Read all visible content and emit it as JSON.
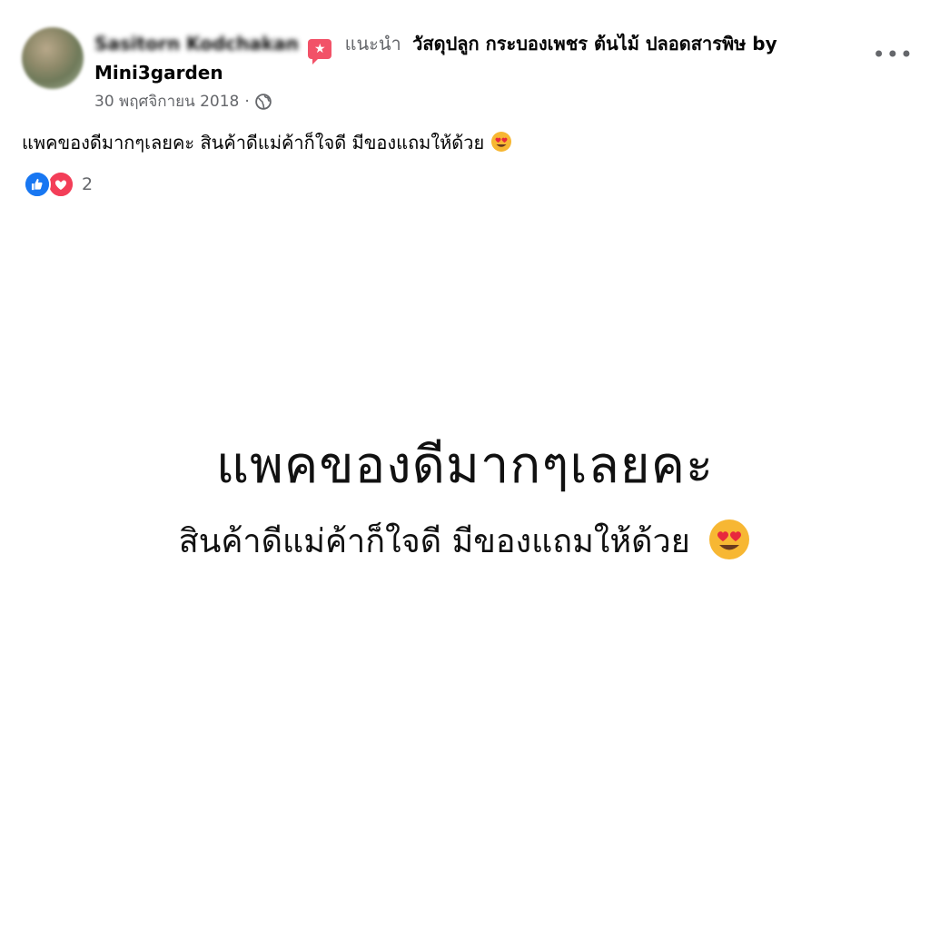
{
  "post": {
    "author": "Sasitorn Kodchakan",
    "recommend_verb": "แนะนำ",
    "page_name_part1": "วัสดุปลูก กระบองเพชร ต้นไม้ ปลอดสารพิษ by",
    "page_name_part2": "Mini3garden",
    "date": "30 พฤศจิกายน 2018",
    "separator": "·",
    "privacy_icon": "globe-icon",
    "more_label": "•••",
    "text": "แพคของดีมากๆเลยคะ สินค้าดีแม่ค้าก็ใจดี มีของแถมให้ด้วย",
    "text_emoji": "heart-eyes-emoji",
    "reaction_icons": [
      "like-icon",
      "love-icon"
    ],
    "reaction_count": "2"
  },
  "image": {
    "line1": "แพคของดีมากๆเลยคะ",
    "line2": "สินค้าดีแม่ค้าก็ใจดี มีของแถมให้ด้วย",
    "emoji": "heart-eyes-emoji"
  },
  "colors": {
    "like": "#1877f2",
    "love": "#f33e58",
    "secondary_text": "#65676b",
    "badge": "#f25268"
  }
}
